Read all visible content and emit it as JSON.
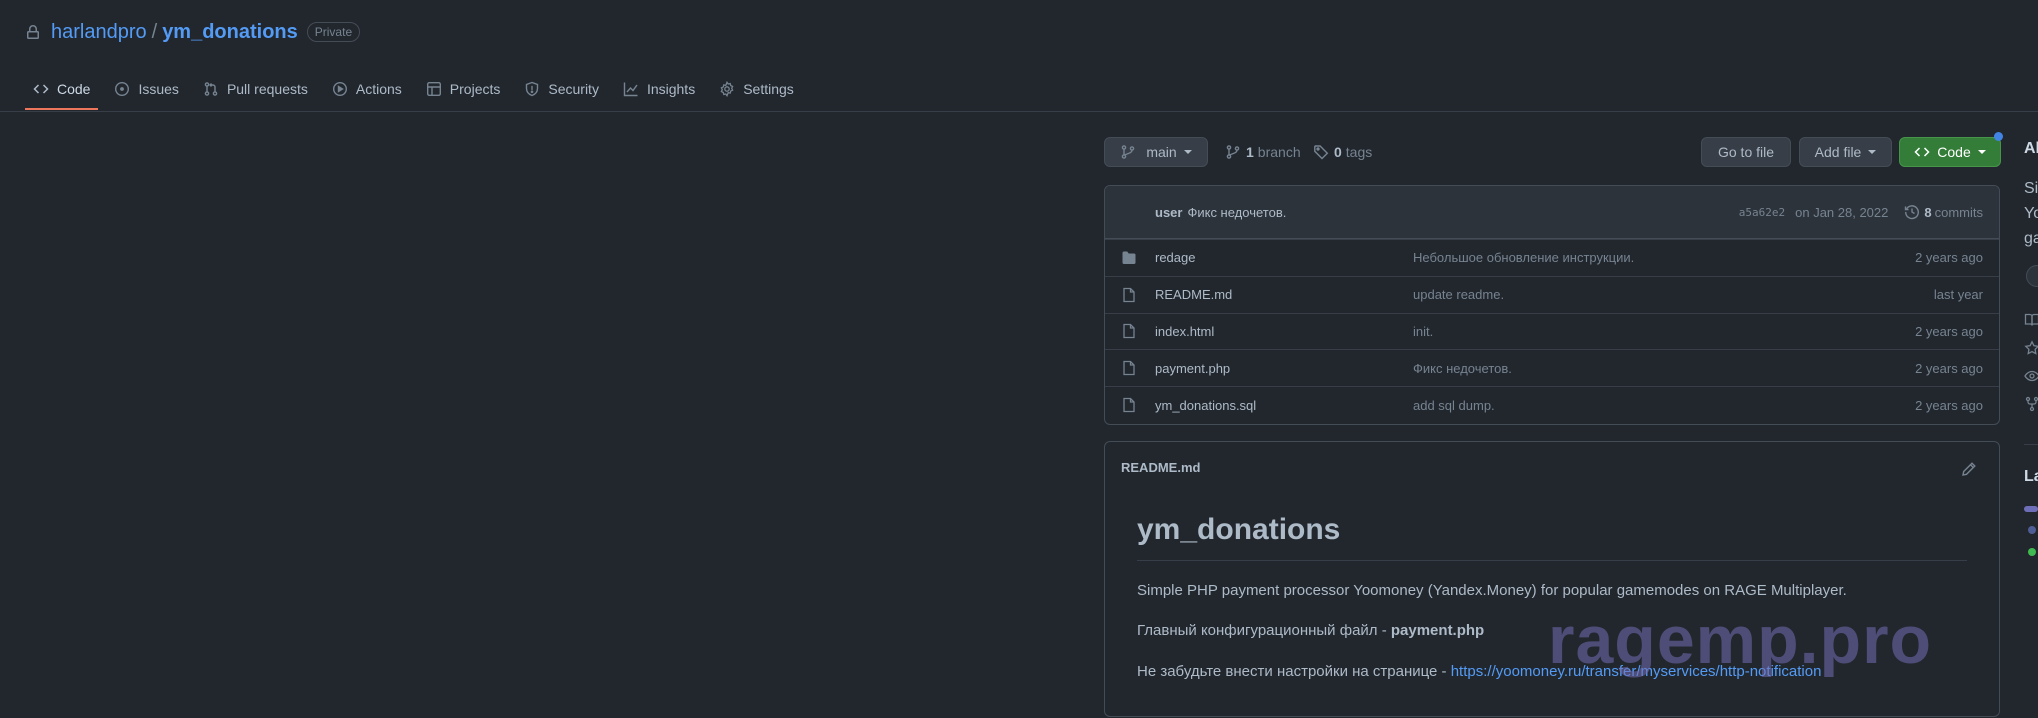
{
  "repo": {
    "owner": "harlandpro",
    "separator": "/",
    "name": "ym_donations",
    "visibility": "Private"
  },
  "tabs": [
    {
      "label": "Code",
      "icon": "code-icon",
      "active": true
    },
    {
      "label": "Issues",
      "icon": "issue-icon"
    },
    {
      "label": "Pull requests",
      "icon": "pull-request-icon"
    },
    {
      "label": "Actions",
      "icon": "play-icon"
    },
    {
      "label": "Projects",
      "icon": "table-icon"
    },
    {
      "label": "Security",
      "icon": "shield-icon"
    },
    {
      "label": "Insights",
      "icon": "graph-icon"
    },
    {
      "label": "Settings",
      "icon": "gear-icon"
    }
  ],
  "toolbar": {
    "branch": "main",
    "branch_count": "1",
    "branch_label": "branch",
    "tag_count": "0",
    "tag_label": "tags",
    "go_to_file": "Go to file",
    "add_file": "Add file",
    "code": "Code"
  },
  "last_commit": {
    "user": "user",
    "message": "Фикс недочетов.",
    "sha": "a5a62e2",
    "date": "on Jan 28, 2022",
    "commit_count": "8",
    "commit_label": "commits"
  },
  "files": [
    {
      "name": "redage",
      "type": "folder",
      "message": "Небольшое обновление инструкции.",
      "age": "2 years ago"
    },
    {
      "name": "README.md",
      "type": "file",
      "message": "update readme.",
      "age": "last year"
    },
    {
      "name": "index.html",
      "type": "file",
      "message": "init.",
      "age": "2 years ago"
    },
    {
      "name": "payment.php",
      "type": "file",
      "message": "Фикс недочетов.",
      "age": "2 years ago"
    },
    {
      "name": "ym_donations.sql",
      "type": "file",
      "message": "add sql dump.",
      "age": "2 years ago"
    }
  ],
  "readme": {
    "filename": "README.md",
    "title": "ym_donations",
    "p1": "Simple PHP payment processor Yoomoney (Yandex.Money) for popular gamemodes on RAGE Multiplayer.",
    "p2_prefix": "Главный конфигурационный файл - ",
    "p2_bold": "payment.php",
    "p3_prefix": "Не забудьте внести настройки на странице - ",
    "p3_link": "https://yoomoney.ru/transfer/myservices/http-notification"
  },
  "watermark": "ragemp.pro",
  "sidebar": {
    "about_fragment": "Al",
    "desc_line1": "Si",
    "desc_line2": "Yo",
    "desc_line3": "ga",
    "languages_fragment": "La"
  },
  "colors": {
    "accent_link": "#539bf5",
    "tab_underline": "#ec775c",
    "code_button": "#347d39",
    "notification_dot": "#4184e4"
  }
}
